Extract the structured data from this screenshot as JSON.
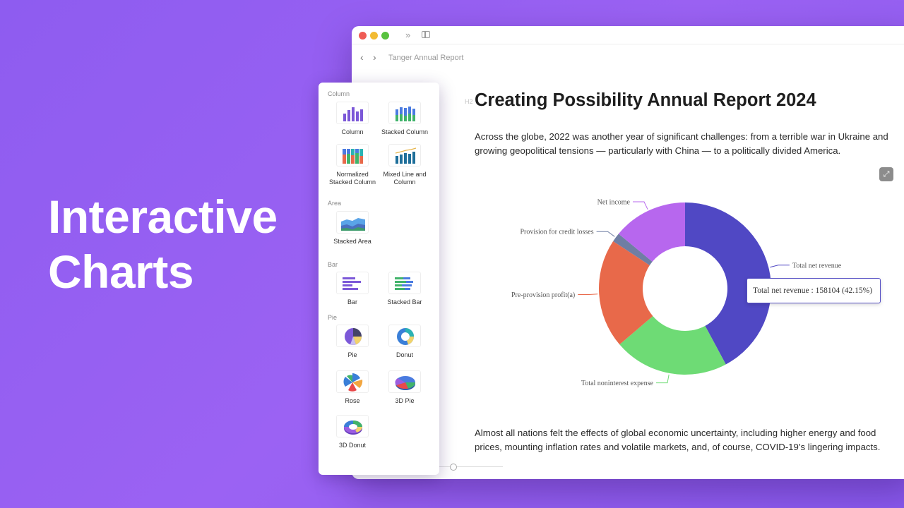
{
  "hero": {
    "line1": "Interactive",
    "line2": "Charts"
  },
  "window": {
    "breadcrumb": "Tanger Annual Report",
    "heading_tag": "H2",
    "title": "Creating Possibility Annual Report 2024",
    "paragraph1": "Across the globe, 2022 was another year of significant challenges: from a terrible war in Ukraine and growing geopolitical tensions — particularly with China — to a politically divided America.",
    "paragraph2": "Almost all nations felt the effects of global economic uncertainty, including higher energy and food prices, mounting inflation rates and volatile markets, and, of course, COVID-19’s lingering impacts."
  },
  "tooltip": "Total net revenue : 158104 (42.15%)",
  "chart_data": {
    "type": "pie",
    "variant": "donut",
    "slices": [
      {
        "label": "Total net revenue",
        "value": 158104,
        "percent": 42.15,
        "color": "#5048c4"
      },
      {
        "label": "Total noninterest expense",
        "value": 81000,
        "percent": 21.6,
        "color": "#6edb75"
      },
      {
        "label": "Pre-provision profit(a)",
        "value": 77000,
        "percent": 20.5,
        "color": "#e8694a"
      },
      {
        "label": "Provision for credit losses",
        "value": 6400,
        "percent": 1.7,
        "color": "#6f7ea3"
      },
      {
        "label": "Net income",
        "value": 52600,
        "percent": 14.05,
        "color": "#b767ee"
      }
    ]
  },
  "panel": {
    "sections": [
      {
        "label": "Column",
        "items": [
          "Column",
          "Stacked Column",
          "Normalized Stacked Column",
          "Mixed Line and Column"
        ]
      },
      {
        "label": "Area",
        "items": [
          "Stacked Area"
        ]
      },
      {
        "label": "Bar",
        "items": [
          "Bar",
          "Stacked Bar"
        ]
      },
      {
        "label": "Pie",
        "items": [
          "Pie",
          "Donut",
          "Rose",
          "3D Pie",
          "3D Donut"
        ]
      }
    ]
  },
  "colors": {
    "background": "#9560f2",
    "accent": "#5048c4"
  }
}
